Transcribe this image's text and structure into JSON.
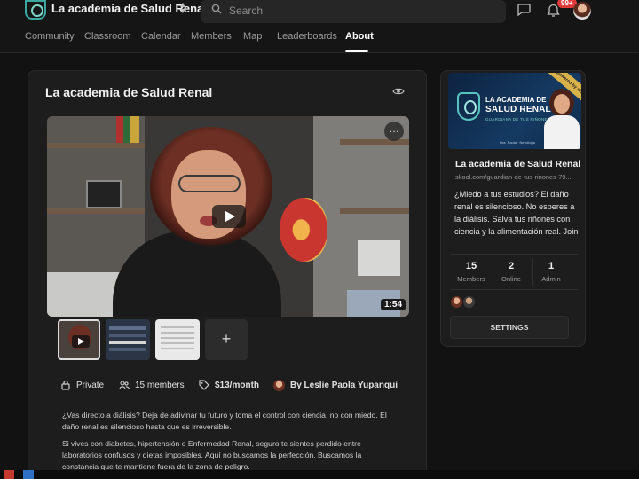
{
  "header": {
    "group_name": "La academia de Salud Renal",
    "search_placeholder": "Search",
    "notification_count": "99+"
  },
  "tabs": [
    {
      "label": "Community",
      "active": false
    },
    {
      "label": "Classroom",
      "active": false
    },
    {
      "label": "Calendar",
      "active": false
    },
    {
      "label": "Members",
      "active": false
    },
    {
      "label": "Map",
      "active": false
    },
    {
      "label": "Leaderboards",
      "active": false
    },
    {
      "label": "About",
      "active": true
    }
  ],
  "main": {
    "title": "La academia de Salud Renal",
    "video_duration": "1:54",
    "meta": {
      "privacy": "Private",
      "members": "15 members",
      "price": "$13/month",
      "creator": "By Leslie Paola Yupanqui"
    },
    "description": [
      "¿Vas directo a diálisis? Deja de adivinar tu futuro y toma el control con ciencia, no con miedo. El daño renal es silencioso hasta que es irreversible.",
      "Si vives con diabetes, hipertensión o Enfermedad Renal, seguro te sientes perdido entre laboratorios confusos y dietas imposibles. Aquí no buscamos la perfección. Buscamos la constancia que te mantiene fuera de la zona de peligro."
    ]
  },
  "side": {
    "banner": {
      "title_line1": "LA ACADEMIA DE",
      "title_line2": "SALUD RENAL",
      "subtitle": "GUARDIANA DE TUS RIÑONES",
      "caption": "Dra. Paola · Nefróloga",
      "ribbon": "powered by skool"
    },
    "title": "La academia de Salud Renal",
    "url": "skool.com/guardian-de-tus-rinones-79...",
    "description": "¿Miedo a tus estudios? El daño renal es silencioso. No esperes a la diálisis. Salva tus riñones con ciencia y la alimentación real. Join",
    "stats": [
      {
        "value": "15",
        "label": "Members"
      },
      {
        "value": "2",
        "label": "Online"
      },
      {
        "value": "1",
        "label": "Admin"
      }
    ],
    "settings_label": "SETTINGS"
  },
  "colors": {
    "background": "#121212",
    "card": "#1d1d1d",
    "accent_teal": "#3aa7a0",
    "badge_red": "#e03b3b"
  },
  "icons": [
    "logo-icon",
    "switch-group-icon",
    "search-icon",
    "chat-icon",
    "bell-icon",
    "eye-icon",
    "play-icon",
    "more-icon",
    "lock-icon",
    "members-icon",
    "tag-icon",
    "plus-icon"
  ]
}
